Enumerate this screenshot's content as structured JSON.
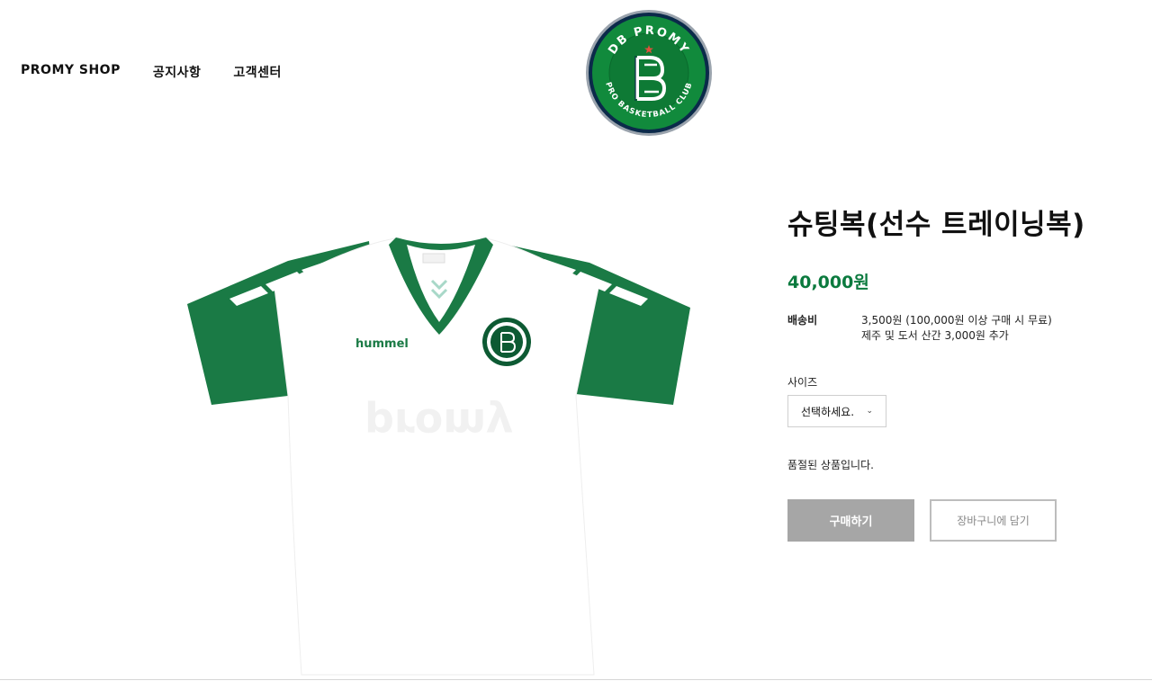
{
  "nav": {
    "items": [
      {
        "label": "PROMY SHOP"
      },
      {
        "label": "공지사항"
      },
      {
        "label": "고객센터"
      }
    ]
  },
  "logo": {
    "top_text": "DB PROMY",
    "bottom_text": "PRO BASKETBALL CLUB",
    "monogram": "DB"
  },
  "product": {
    "title": "슈팅복(선수 트레이닝복)",
    "price": "40,000원",
    "shipping_label": "배송비",
    "shipping_line1": "3,500원 (100,000원 이상 구매 시 무료)",
    "shipping_line2": "제주 및 도서 산간 3,000원 추가",
    "size_label": "사이즈",
    "size_selected": "선택하세요.",
    "soldout_text": "품절된 상품입니다.",
    "buy_label": "구매하기",
    "cart_label": "장바구니에 담기",
    "jersey_brand": "hummel"
  },
  "colors": {
    "brand_green": "#0b7a3e",
    "jersey_green": "#1a7a45",
    "disabled_button": "#a6a6a6"
  }
}
